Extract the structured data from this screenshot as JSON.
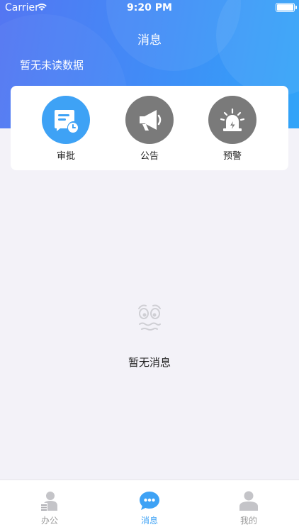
{
  "status_bar": {
    "carrier": "Carrier",
    "time": "9:20 PM"
  },
  "header": {
    "title": "消息",
    "unread_text": "暂无未读数据"
  },
  "entries": [
    {
      "label": "审批",
      "icon": "approval-icon",
      "color": "#3ea2f5"
    },
    {
      "label": "公告",
      "icon": "megaphone-icon",
      "color": "#7a7a7a"
    },
    {
      "label": "预警",
      "icon": "alarm-icon",
      "color": "#7a7a7a"
    }
  ],
  "empty": {
    "text": "暂无消息",
    "icon": "empty-face-icon"
  },
  "tabbar": {
    "tabs": [
      {
        "label": "办公",
        "icon": "office-icon",
        "active": false
      },
      {
        "label": "消息",
        "icon": "message-icon",
        "active": true
      },
      {
        "label": "我的",
        "icon": "profile-icon",
        "active": false
      }
    ],
    "active_color": "#3ea2f5",
    "inactive_color": "#9a9a9a"
  }
}
